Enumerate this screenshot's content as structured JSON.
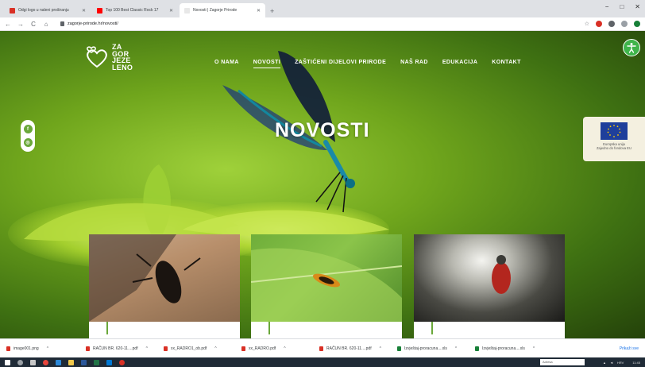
{
  "browser": {
    "tabs": [
      {
        "label": "Odgi logo u naleni proširanju",
        "favicon_color": "#d93025",
        "active": false
      },
      {
        "label": "Top 100 Best Classic Rock 17",
        "favicon_color": "#ff0000",
        "active": false
      },
      {
        "label": "Novosti | Zagorje Prirode",
        "favicon_color": "#ffffff",
        "active": true
      }
    ],
    "new_tab": "+",
    "window_controls": {
      "minimize": "−",
      "maximize": "□",
      "close": "✕"
    },
    "nav": {
      "back": "←",
      "forward": "→",
      "reload": "C",
      "home": "⌂"
    },
    "url": "zagorje-prirode.hr/novosti/"
  },
  "site": {
    "logo": {
      "line1": "ZA",
      "line2": "GOR",
      "line3": "JEZE",
      "line4": "LENO"
    },
    "nav": [
      "O NAMA",
      "NOVOSTI",
      "ZAŠTIĆENI DIJELOVI PRIRODE",
      "NAŠ RAD",
      "EDUKACIJA",
      "KONTAKT"
    ],
    "active_nav": "NOVOSTI",
    "hero_title": "NOVOSTI",
    "eu_badge": {
      "line1": "Europska unija",
      "line2": "Zajedno do fondova EU"
    },
    "social": {
      "facebook": "f",
      "instagram": "◎"
    },
    "accessibility_icon": "accessibility-icon",
    "colors": {
      "brand_green": "#6aa83a",
      "accessibility_green": "#3fb44a",
      "eu_blue": "#1f3f9b"
    }
  },
  "downloads": {
    "items": [
      {
        "name": "image001.png",
        "icon_color": "#d93025"
      },
      {
        "name": "RAČUN BR. 620-11....pdf",
        "icon_color": "#d93025"
      },
      {
        "name": "xx_RADRO1_ob.pdf",
        "icon_color": "#d93025"
      },
      {
        "name": "xx_RADRO.pdf",
        "icon_color": "#d93025"
      },
      {
        "name": "RAČUN BR. 620-11....pdf",
        "icon_color": "#d93025"
      },
      {
        "name": "Izvještaj-proracuna....xls",
        "icon_color": "#188038"
      },
      {
        "name": "Izvještaj-proracuna....xls",
        "icon_color": "#188038"
      }
    ],
    "show_all": "Prikaži sve"
  },
  "taskbar": {
    "search_placeholder": "Adresa",
    "time": "11:45",
    "date": "",
    "lang": "HRV"
  }
}
